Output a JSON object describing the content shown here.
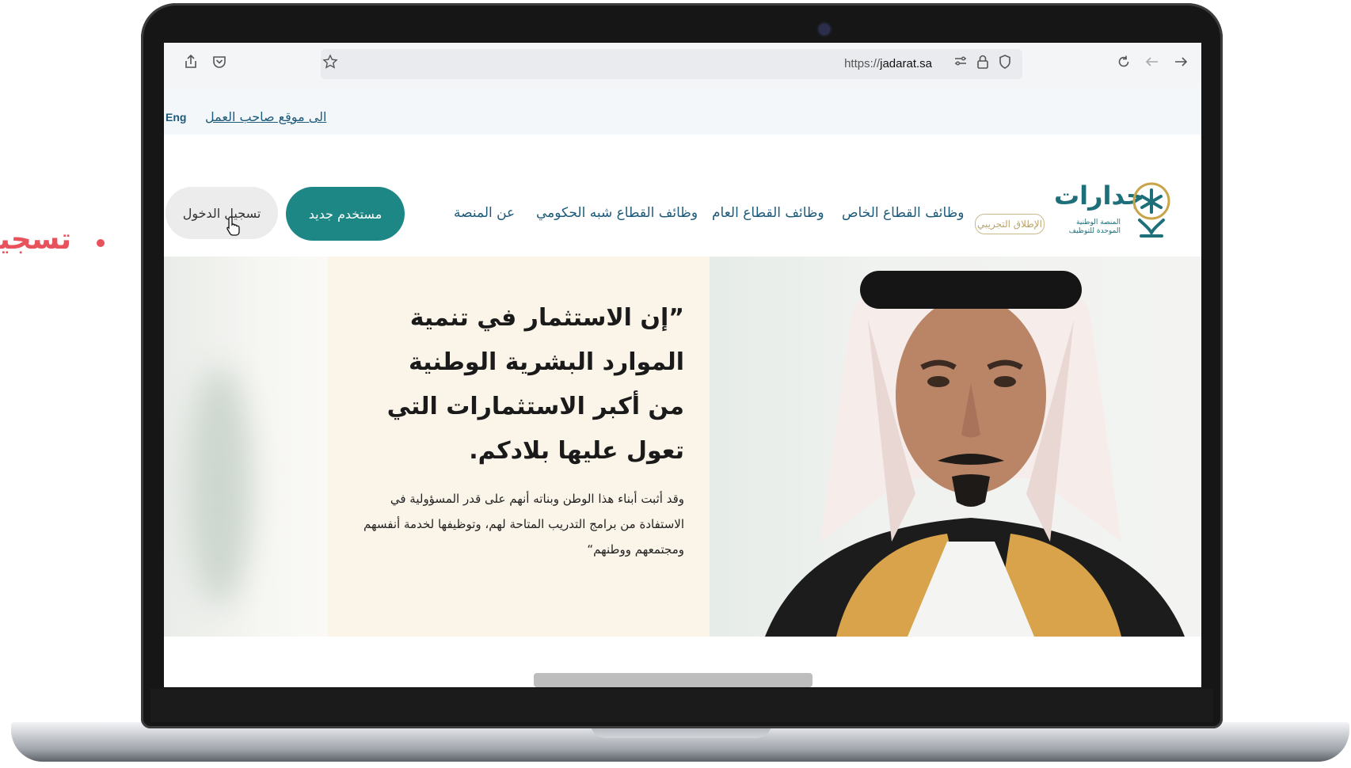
{
  "side_bullet": {
    "text": "تسجيل"
  },
  "browser": {
    "url_prefix": "https://",
    "url_host": "jadarat.sa",
    "icons": [
      "share-icon",
      "pocket-icon",
      "bookmark-star-icon",
      "tune-icon",
      "lock-icon",
      "shield-icon",
      "reload-icon",
      "back-icon",
      "forward-icon"
    ]
  },
  "topbar": {
    "eng_label": "Eng",
    "employer_link": "الى موقع صاحب العمل"
  },
  "nav": {
    "login_label": "تسجيل الدخول",
    "new_user_label": "مستخدم جديد",
    "items": [
      "عن المنصة",
      "وظائف القطاع شبه الحكومي",
      "وظائف القطاع العام",
      "وظائف القطاع الخاص"
    ]
  },
  "logo": {
    "name": "جدارات",
    "subtitle": "المنصة الوطنية الموحدة للتوظيف",
    "beta_badge": "الإطلاق التجريبي"
  },
  "hero": {
    "quote_title": "”إن الاستثمار في تنمية الموارد البشرية الوطنية من أكبر الاستثمارات التي تعول عليها بلادكم.",
    "quote_body": "وقد أثبت أبناء هذا الوطن وبناته أنهم على قدر المسؤولية في الاستفادة من برامج التدريب المتاحة لهم، وتوظيفها لخدمة أنفسهم ومجتمعهم ووطنهم“"
  },
  "colors": {
    "accent": "#1d8785",
    "nav_text": "#1d5b7a",
    "bullet": "#e8525c",
    "quote_panel": "#fbf5e9"
  }
}
